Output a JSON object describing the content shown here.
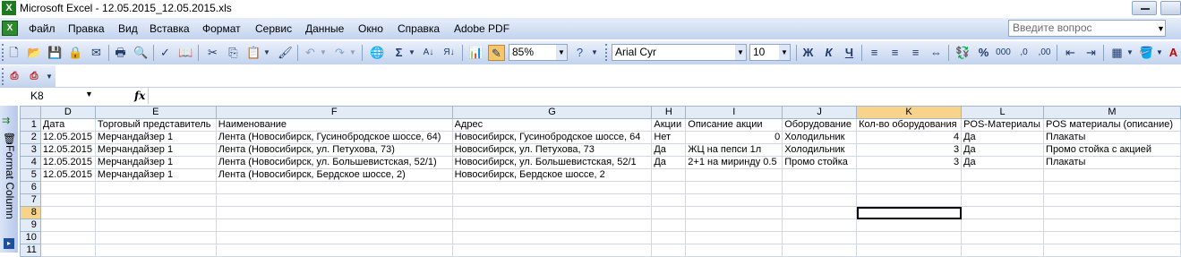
{
  "window": {
    "title": "Microsoft Excel - 12.05.2015_12.05.2015.xls"
  },
  "menu": {
    "items": [
      "Файл",
      "Правка",
      "Вид",
      "Вставка",
      "Формат",
      "Сервис",
      "Данные",
      "Окно",
      "Справка",
      "Adobe PDF"
    ],
    "search_placeholder": "Введите вопрос"
  },
  "toolbar": {
    "sigma": "Σ",
    "zoom": "85%",
    "font_name": "Arial Cyr",
    "font_size": "10",
    "bold": "Ж",
    "italic": "К",
    "underline": "Ч",
    "percent": "%",
    "thousands": "000"
  },
  "formula_bar": {
    "name_box": "K8",
    "fx": "fx",
    "formula": ""
  },
  "left_pane": {
    "label": "Format Column"
  },
  "sheet": {
    "columns": [
      "D",
      "E",
      "F",
      "G",
      "H",
      "I",
      "J",
      "K",
      "L",
      "M"
    ],
    "selected_column": "K",
    "selected_row": "8",
    "row_numbers": [
      "1",
      "2",
      "3",
      "4",
      "5",
      "6",
      "7",
      "8",
      "9",
      "10",
      "11"
    ],
    "rows": [
      [
        "Дата",
        "Торговый представитель",
        "Наименование",
        "Адрес",
        "Акции",
        "Описание акции",
        "Оборудование",
        "Кол-во оборудования",
        "POS-Материалы",
        "POS материалы (описание)"
      ],
      [
        "12.05.2015",
        "Мерчандайзер 1",
        "Лента (Новосибирск, Гусинобродское шоссе, 64)",
        "Новосибирск, Гусинобродское шоссе, 64",
        "Нет",
        "0",
        "Холодильник",
        "4",
        "Да",
        "Плакаты"
      ],
      [
        "12.05.2015",
        "Мерчандайзер 1",
        "Лента (Новосибирск, ул. Петухова, 73)",
        "Новосибирск, ул. Петухова, 73",
        "Да",
        "ЖЦ на пепси 1л",
        "Холодильник",
        "3",
        "Да",
        "Промо стойка с акцией"
      ],
      [
        "12.05.2015",
        "Мерчандайзер 1",
        "Лента (Новосибирск, ул. Большевистская, 52/1)",
        "Новосибирск, ул. Большевистская, 52/1",
        "Да",
        "2+1 на миринду 0.5",
        "Промо стойка",
        "3",
        "Да",
        "Плакаты"
      ],
      [
        "12.05.2015",
        "Мерчандайзер 1",
        "Лента (Новосибирск, Бердское шоссе, 2)",
        "Новосибирск, Бердское шоссе, 2",
        "",
        "",
        "",
        "",
        "",
        ""
      ],
      [
        "",
        "",
        "",
        "",
        "",
        "",
        "",
        "",
        "",
        ""
      ],
      [
        "",
        "",
        "",
        "",
        "",
        "",
        "",
        "",
        "",
        ""
      ],
      [
        "",
        "",
        "",
        "",
        "",
        "",
        "",
        "",
        "",
        ""
      ],
      [
        "",
        "",
        "",
        "",
        "",
        "",
        "",
        "",
        "",
        ""
      ],
      [
        "",
        "",
        "",
        "",
        "",
        "",
        "",
        "",
        "",
        ""
      ],
      [
        "",
        "",
        "",
        "",
        "",
        "",
        "",
        "",
        "",
        ""
      ]
    ]
  }
}
